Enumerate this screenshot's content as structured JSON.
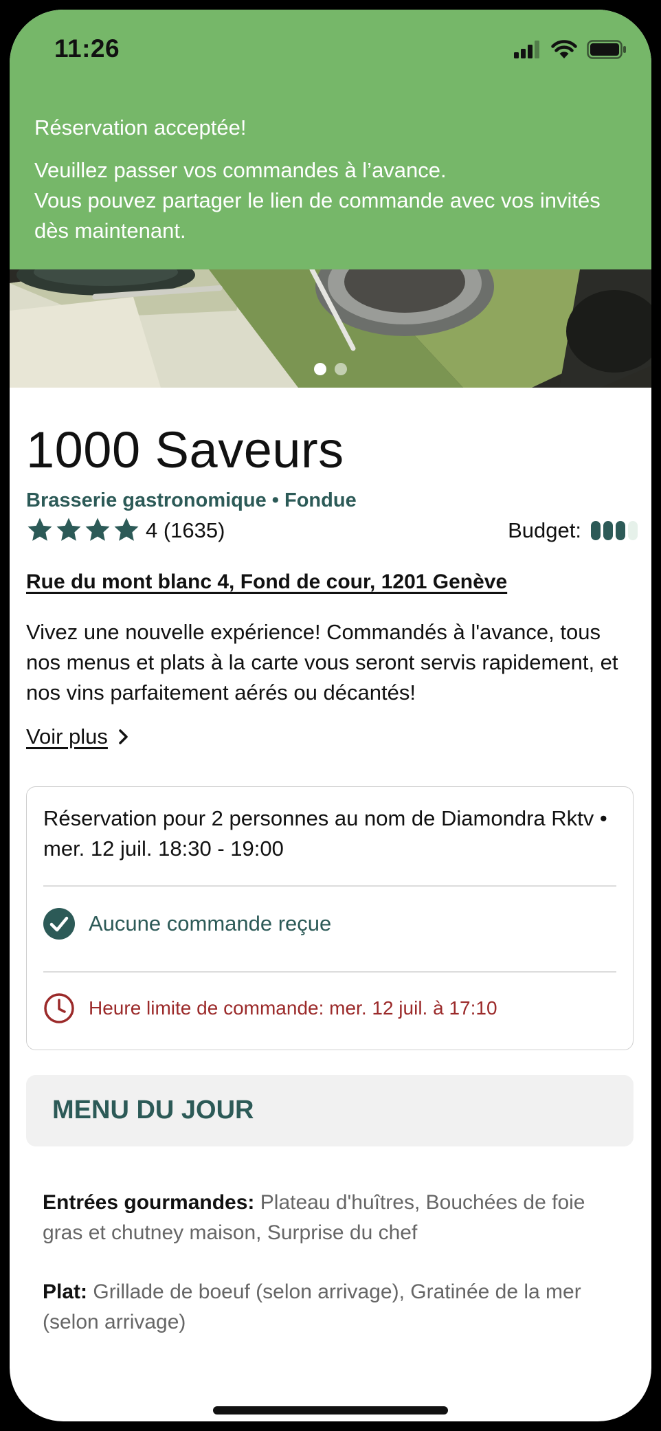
{
  "status_bar": {
    "time": "11:26"
  },
  "banner": {
    "title": "Réservation acceptée!",
    "message": "Veuillez passer vos commandes à l’avance.\nVous pouvez partager le lien de commande avec vos invités dès maintenant."
  },
  "carousel": {
    "page_count": 2,
    "active_index": 0
  },
  "restaurant": {
    "name": "1000 Saveurs",
    "tags": "Brasserie gastronomique • Fondue",
    "rating_value": 4,
    "rating_text": "4 (1635)",
    "budget_label": "Budget:",
    "budget_level": 3,
    "budget_max": 4,
    "address": "Rue du mont blanc 4, Fond de cour, 1201 Genève",
    "description": "Vivez une nouvelle expérience! Commandés à l'avance, tous nos menus et plats à la carte vous seront servis rapidement, et nos vins parfaitement aérés ou décantés!",
    "see_more": "Voir plus"
  },
  "reservation": {
    "text": "Réservation pour 2 personnes au nom de Diamondra Rktv • mer. 12 juil. 18:30 - 19:00",
    "order_status": "Aucune commande reçue",
    "deadline": "Heure limite de commande: mer. 12 juil. à 17:10"
  },
  "menu": {
    "title": "MENU DU JOUR",
    "sections": [
      {
        "label": "Entrées gourmandes:",
        "items": "Plateau d'huîtres, Bouchées de foie gras et chutney maison, Surprise du chef"
      },
      {
        "label": "Plat:",
        "items": "Grillade de boeuf (selon arrivage), Gratinée de la mer (selon arrivage)"
      }
    ]
  },
  "colors": {
    "banner": "#76b769",
    "accent": "#2c5a57",
    "deadline": "#9b2a2a"
  },
  "icons": [
    "signal-icon",
    "wifi-icon",
    "battery-icon",
    "star-icon",
    "chevron-right-icon",
    "check-circle-icon",
    "clock-icon"
  ]
}
